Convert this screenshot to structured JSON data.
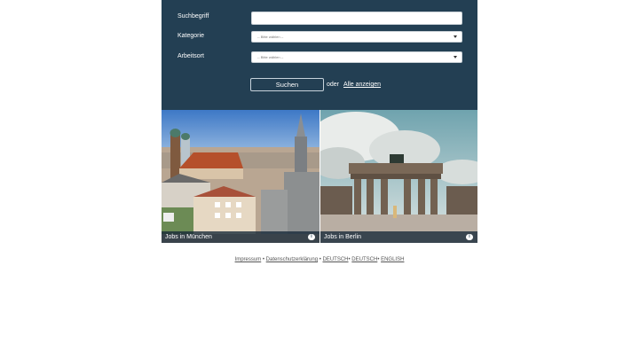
{
  "search_form": {
    "keyword_label": "Suchbegriff",
    "keyword_value": "",
    "category_label": "Kategorie",
    "category_selected": "-- Bitte wählen --",
    "location_label": "Arbeitsort",
    "location_selected": "-- Bitte wählen --",
    "search_button": "Suchen",
    "or_text": "oder",
    "show_all_link": "Alle anzeigen"
  },
  "tiles": [
    {
      "caption": "Jobs in München",
      "info": "i"
    },
    {
      "caption": "Jobs in Berlin",
      "info": "i"
    }
  ],
  "footer": {
    "links": [
      "Impressum",
      "Datenschutzerklärung",
      "DEUTSCH",
      "DEUTSCH",
      "ENGLISH"
    ],
    "separator": "•"
  },
  "colors": {
    "panel_background": "#233f53",
    "page_background": "#ffffff"
  }
}
